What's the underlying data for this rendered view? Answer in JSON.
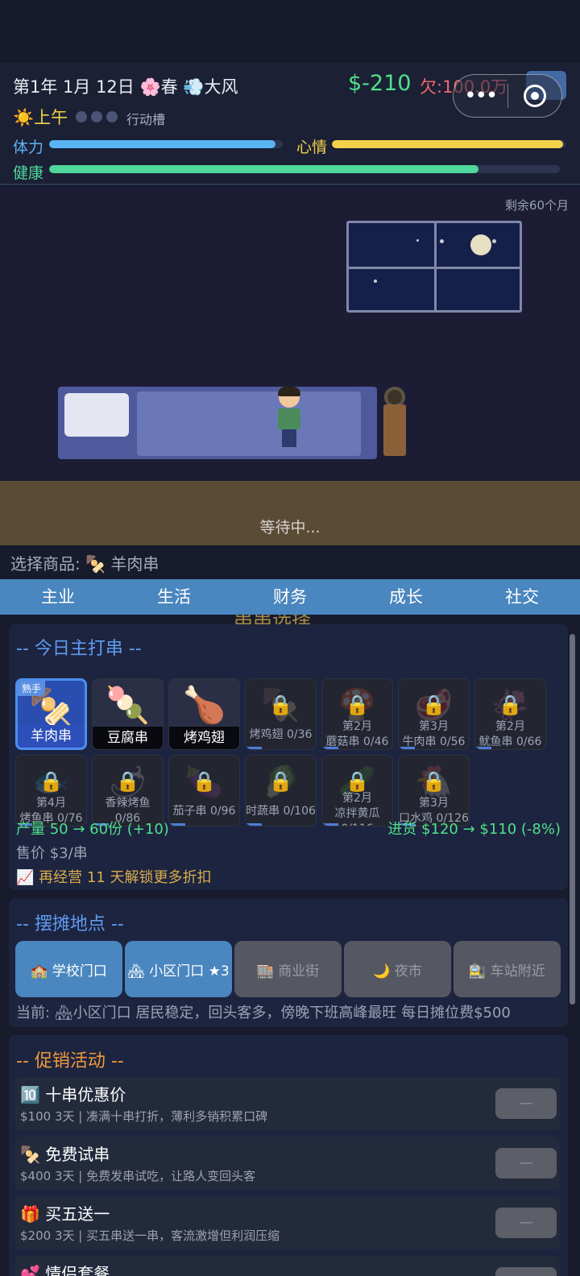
{
  "hud": {
    "date": "第1年 1月 12日 🌸春 💨大风",
    "money": "$-210",
    "debt": "欠:100.0万",
    "time": "☀️上午",
    "action_slot_label": "行动槽",
    "stamina_label": "体力",
    "mood_label": "心情",
    "health_label": "健康",
    "stamina": 0.97,
    "mood": 0.99,
    "health": 0.84,
    "colors": {
      "stamina": "#58b4f5",
      "mood": "#f5d24a",
      "health": "#4fd89b"
    }
  },
  "capsule": {
    "more": "•••"
  },
  "scene": {
    "remaining": "剩余60个月",
    "waiting": "等待中..."
  },
  "select_line": "选择商品: 🍢 羊肉串",
  "tabs": [
    "主业",
    "生活",
    "财务",
    "成长",
    "社交"
  ],
  "panel_title_partial": "串串选择",
  "skewer": {
    "header": "-- 今日主打串 --",
    "items": [
      {
        "name": "羊肉串",
        "icon": "🍢",
        "badge": "熟手",
        "state": "active"
      },
      {
        "name": "豆腐串",
        "icon": "🍡",
        "state": "unlocked"
      },
      {
        "name": "烤鸡翅",
        "icon": "🍗",
        "state": "unlocked"
      },
      {
        "l1": "",
        "l2": "烤鸡翅 0/36",
        "state": "locked"
      },
      {
        "l1": "第2月",
        "l2": "蘑菇串 0/46",
        "state": "locked"
      },
      {
        "l1": "第3月",
        "l2": "牛肉串 0/56",
        "state": "locked"
      },
      {
        "l1": "第2月",
        "l2": "鱿鱼串 0/66",
        "state": "locked"
      },
      {
        "l1": "第4月",
        "l2": "烤鱼串 0/76",
        "state": "locked"
      },
      {
        "l1": "香辣烤鱼",
        "l2": "0/86",
        "state": "locked"
      },
      {
        "l1": "",
        "l2": "茄子串 0/96",
        "state": "locked"
      },
      {
        "l1": "",
        "l2": "时蔬串 0/106",
        "state": "locked"
      },
      {
        "l1": "第2月",
        "l2": "凉拌黄瓜",
        "l3": "0/116",
        "state": "locked"
      },
      {
        "l1": "第3月",
        "l2": "口水鸡 0/126",
        "state": "locked"
      }
    ],
    "output": "产量 50 → 60份 (+10)",
    "purchase": "进货 $120 → $110 (-8%)",
    "price": "售价 $3/串",
    "unlock_hint": "📈 再经营 11 天解锁更多折扣"
  },
  "location": {
    "header": "-- 摆摊地点 --",
    "items": [
      {
        "label": "🏫 学校门口",
        "on": true
      },
      {
        "label": "🏘 小区门口 ★3",
        "on": true
      },
      {
        "label": "🏬 商业街",
        "on": false
      },
      {
        "label": "🌙 夜市",
        "on": false
      },
      {
        "label": "🚉 车站附近",
        "on": false
      }
    ],
    "current": "当前: 🏘小区门口  居民稳定，回头客多，傍晚下班高峰最旺  每日摊位费$500"
  },
  "promo": {
    "header": "-- 促销活动 --",
    "items": [
      {
        "title": "🔟 十串优惠价",
        "desc": "$100 3天 | 凑满十串打折，薄利多销积累口碑",
        "btn": "—"
      },
      {
        "title": "🍢 免费试串",
        "desc": "$400 3天 | 免费发串试吃，让路人变回头客",
        "btn": "—"
      },
      {
        "title": "🎁 买五送一",
        "desc": "$200 3天 | 买五串送一串，客流激增但利润压缩",
        "btn": "—"
      },
      {
        "title": "💕 情侣套餐",
        "desc": "",
        "btn": "—"
      }
    ]
  }
}
